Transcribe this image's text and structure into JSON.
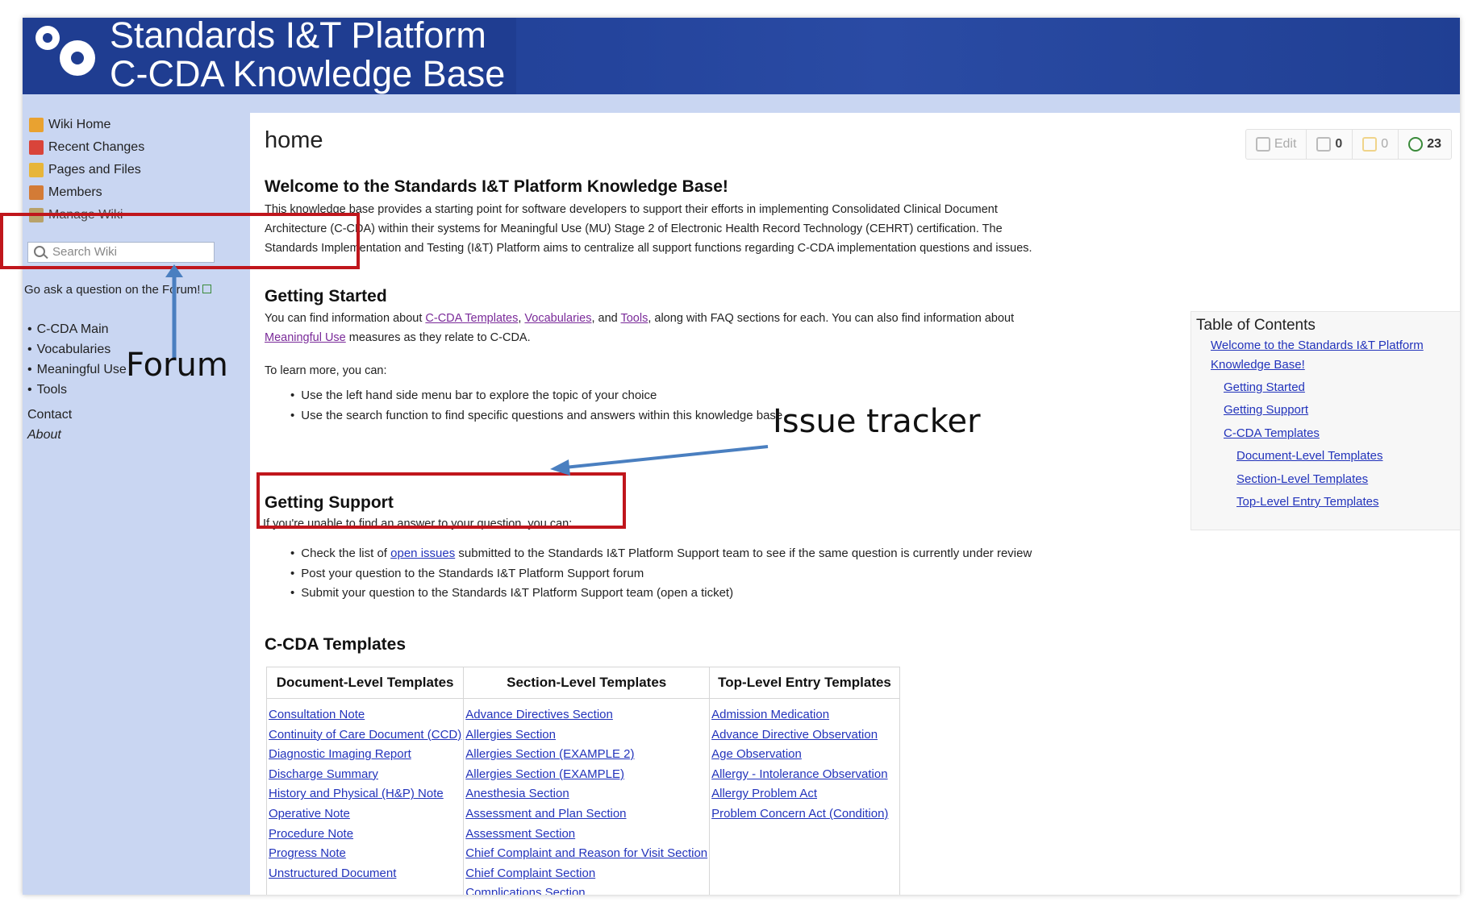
{
  "banner": {
    "line1": "Standards I&T Platform",
    "line2": "C-CDA Knowledge Base"
  },
  "sidebar": {
    "nav": [
      {
        "label": "Wiki Home",
        "icon": "house-icon"
      },
      {
        "label": "Recent Changes",
        "icon": "calendar-icon"
      },
      {
        "label": "Pages and Files",
        "icon": "pages-icon"
      },
      {
        "label": "Members",
        "icon": "members-icon"
      },
      {
        "label": "Manage Wiki",
        "icon": "gear-icon"
      }
    ],
    "search_placeholder": "Search Wiki",
    "forum_prompt": "Go ask a question on the Forum!",
    "links": [
      "C-CDA Main",
      "Vocabularies",
      "Meaningful Use",
      "Tools"
    ],
    "contact": "Contact",
    "about": "About"
  },
  "page": {
    "title": "home",
    "toolbar": {
      "edit": "Edit",
      "attachments": "0",
      "comments": "0",
      "revisions": "23"
    }
  },
  "welcome": {
    "heading": "Welcome to the Standards I&T Platform Knowledge Base!",
    "lines": [
      "This knowledge base provides a starting point for software developers to support their efforts in implementing Consolidated Clinical Document",
      "Architecture (C-CDA) within their systems for Meaningful Use (MU) Stage 2 of Electronic Health Record Technology (CEHRT) certification. The",
      "Standards Implementation and Testing (I&T) Platform aims to centralize all support functions regarding C-CDA implementation questions and issues."
    ]
  },
  "getting_started": {
    "heading": "Getting Started",
    "p1_a": "You can find information about ",
    "link_templates": "C-CDA Templates",
    "sep1": ", ",
    "link_vocab": "Vocabularies",
    "sep2": ", and ",
    "link_tools": "Tools",
    "p1_b": ", along with FAQ sections for each. You can also find information about",
    "link_mu": "Meaningful Use",
    "p1_c": " measures as they relate to C-CDA.",
    "learn_more": "To learn more, you can:",
    "bullets": [
      "Use the left hand side menu bar to explore the topic of your choice",
      "Use the search function to find specific questions and answers within this knowledge base"
    ]
  },
  "getting_support": {
    "heading": "Getting Support",
    "intro": "If you're unable to find an answer to your question, you can:",
    "b1_a": "Check the list of ",
    "b1_link": "open issues",
    "b1_b": " submitted to the Standards I&T Platform Support team to see if the same question is currently under review",
    "b2": "Post your question to the Standards I&T Platform Support forum",
    "b3": "Submit your question to the Standards I&T Platform Support team (open a ticket)"
  },
  "templates": {
    "heading": "C-CDA Templates",
    "columns": [
      "Document-Level Templates",
      "Section-Level Templates",
      "Top-Level Entry Templates"
    ],
    "document": [
      "Consultation Note",
      "Continuity of Care Document (CCD)",
      "Diagnostic Imaging Report",
      "Discharge Summary",
      "History and Physical (H&P) Note",
      "Operative Note",
      "Procedure Note",
      "Progress Note",
      "Unstructured Document"
    ],
    "section": [
      "Advance Directives Section",
      "Allergies Section",
      "Allergies Section (EXAMPLE 2)",
      "Allergies Section (EXAMPLE)",
      "Anesthesia Section",
      "Assessment and Plan Section",
      "Assessment Section",
      "Chief Complaint and Reason for Visit Section",
      "Chief Complaint Section",
      "Complications Section"
    ],
    "entry": [
      "Admission Medication",
      "Advance Directive Observation",
      "Age Observation",
      "Allergy - Intolerance Observation",
      "Allergy Problem Act",
      "Problem Concern Act (Condition)"
    ]
  },
  "toc": {
    "title": "Table of Contents",
    "items": [
      {
        "text": "Welcome to the Standards I&T Platform",
        "level": 1
      },
      {
        "text": "Knowledge Base!",
        "level": 1
      },
      {
        "text": "Getting Started",
        "level": 2
      },
      {
        "text": "Getting Support",
        "level": 2
      },
      {
        "text": "C-CDA Templates",
        "level": 2
      },
      {
        "text": "Document-Level Templates",
        "level": 3
      },
      {
        "text": "Section-Level Templates",
        "level": 3
      },
      {
        "text": "Top-Level Entry Templates",
        "level": 3
      }
    ]
  },
  "annotations": {
    "forum": "Forum",
    "issue_tracker": "Issue tracker"
  },
  "colors": {
    "banner": "#1f3d91",
    "sidebar": "#c9d6f2",
    "annotation_red": "#c0161c",
    "arrow_blue": "#4a7fc0",
    "link": "#2233bb"
  }
}
